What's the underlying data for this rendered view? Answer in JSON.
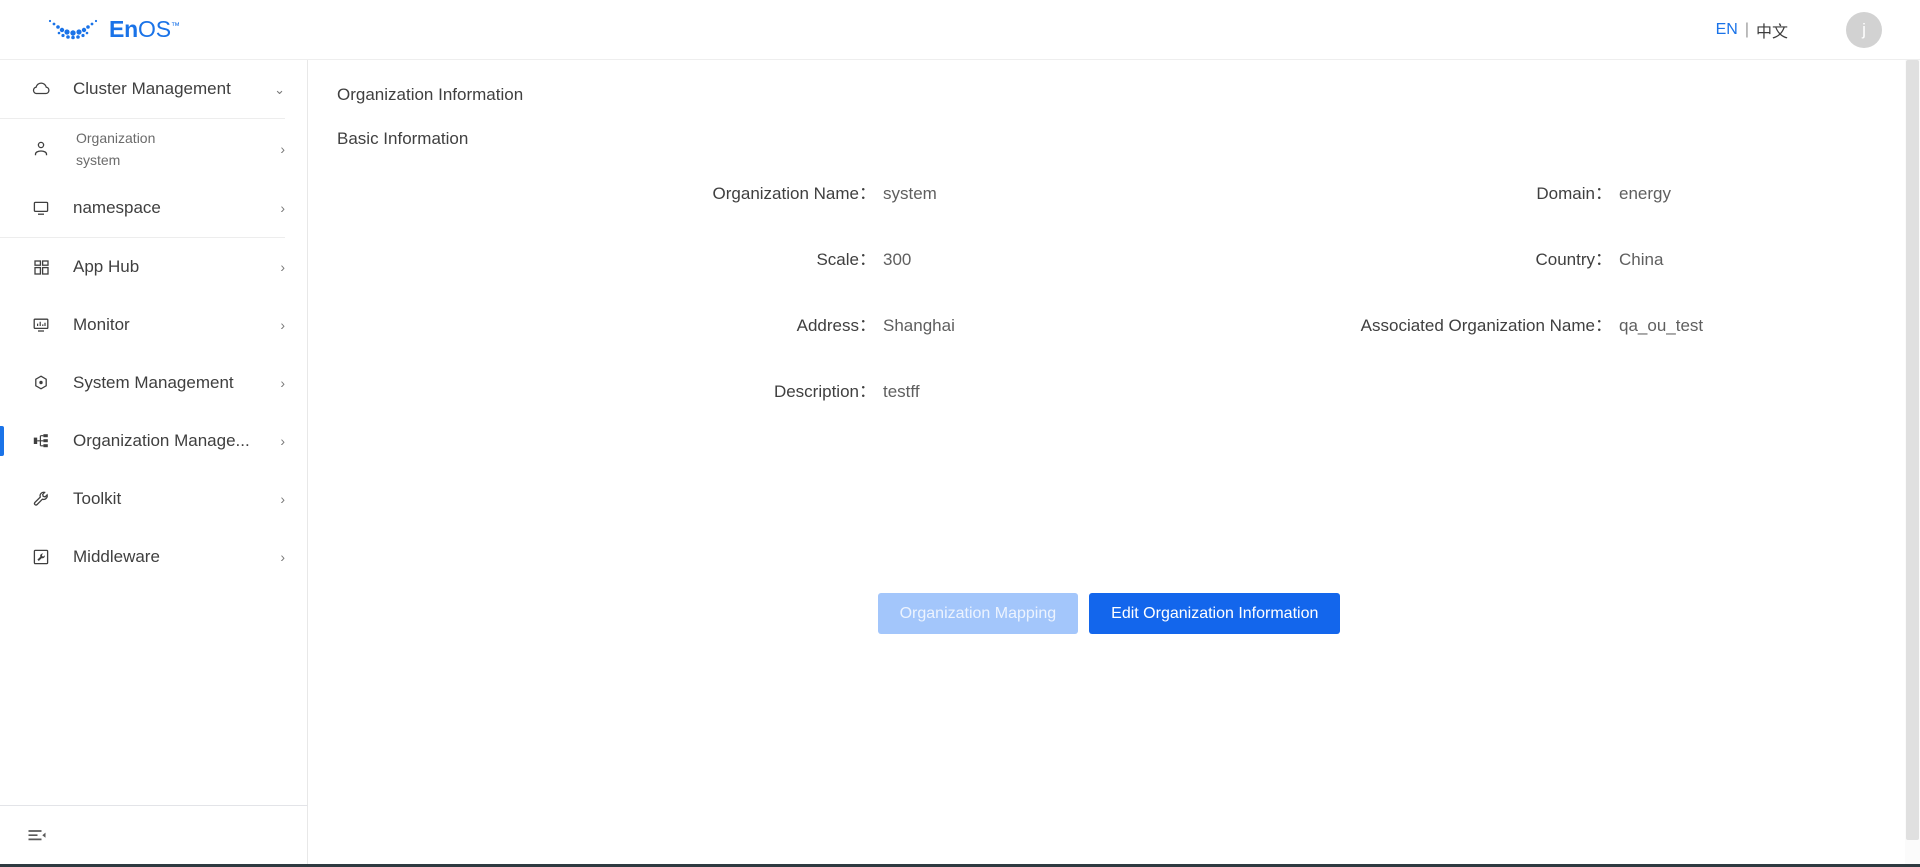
{
  "brand": {
    "name_bold": "En",
    "name_light": "OS",
    "trademark": "™",
    "logo_icon": "enos-dots-logo",
    "accent_color": "#1a73e8"
  },
  "topbar": {
    "lang_en": "EN",
    "lang_separator": "|",
    "lang_cn": "中文",
    "avatar_initial": "j"
  },
  "sidebar": {
    "items": [
      {
        "label": "Cluster Management",
        "icon": "cloud-icon",
        "chevron": "⌄",
        "chevron_dir": "down",
        "active": false,
        "two_line": false
      },
      {
        "label": "Organization",
        "label2": "system",
        "icon": "user-icon",
        "chevron": "›",
        "chevron_dir": "right",
        "active": false,
        "two_line": true
      },
      {
        "label": "namespace",
        "icon": "monitor-icon",
        "chevron": "›",
        "chevron_dir": "right",
        "active": false,
        "two_line": false
      },
      {
        "label": "App Hub",
        "icon": "grid-apps-icon",
        "chevron": "›",
        "chevron_dir": "right",
        "active": false,
        "two_line": false
      },
      {
        "label": "Monitor",
        "icon": "dashboard-icon",
        "chevron": "›",
        "chevron_dir": "right",
        "active": false,
        "two_line": false
      },
      {
        "label": "System Management",
        "icon": "hexagon-gear-icon",
        "chevron": "›",
        "chevron_dir": "right",
        "active": false,
        "two_line": false
      },
      {
        "label": "Organization Manage...",
        "icon": "org-chart-icon",
        "chevron": "›",
        "chevron_dir": "right",
        "active": true,
        "two_line": false
      },
      {
        "label": "Toolkit",
        "icon": "wrench-icon",
        "chevron": "›",
        "chevron_dir": "right",
        "active": false,
        "two_line": false
      },
      {
        "label": "Middleware",
        "icon": "box-wrench-icon",
        "chevron": "›",
        "chevron_dir": "right",
        "active": false,
        "two_line": false
      }
    ],
    "footer_icon": "menu-fold-icon"
  },
  "main": {
    "page_title": "Organization Information",
    "section_title": "Basic Information",
    "fields_left": [
      {
        "label": "Organization Name：",
        "value": "system"
      },
      {
        "label": "Scale：",
        "value": "300"
      },
      {
        "label": "Address：",
        "value": "Shanghai"
      },
      {
        "label": "Description：",
        "value": "testff"
      }
    ],
    "fields_right": [
      {
        "label": "Domain：",
        "value": "energy"
      },
      {
        "label": "Country：",
        "value": "China"
      },
      {
        "label": "Associated Organization Name：",
        "value": "qa_ou_test"
      }
    ],
    "buttons": {
      "mapping": "Organization Mapping",
      "edit": "Edit Organization Information"
    }
  }
}
